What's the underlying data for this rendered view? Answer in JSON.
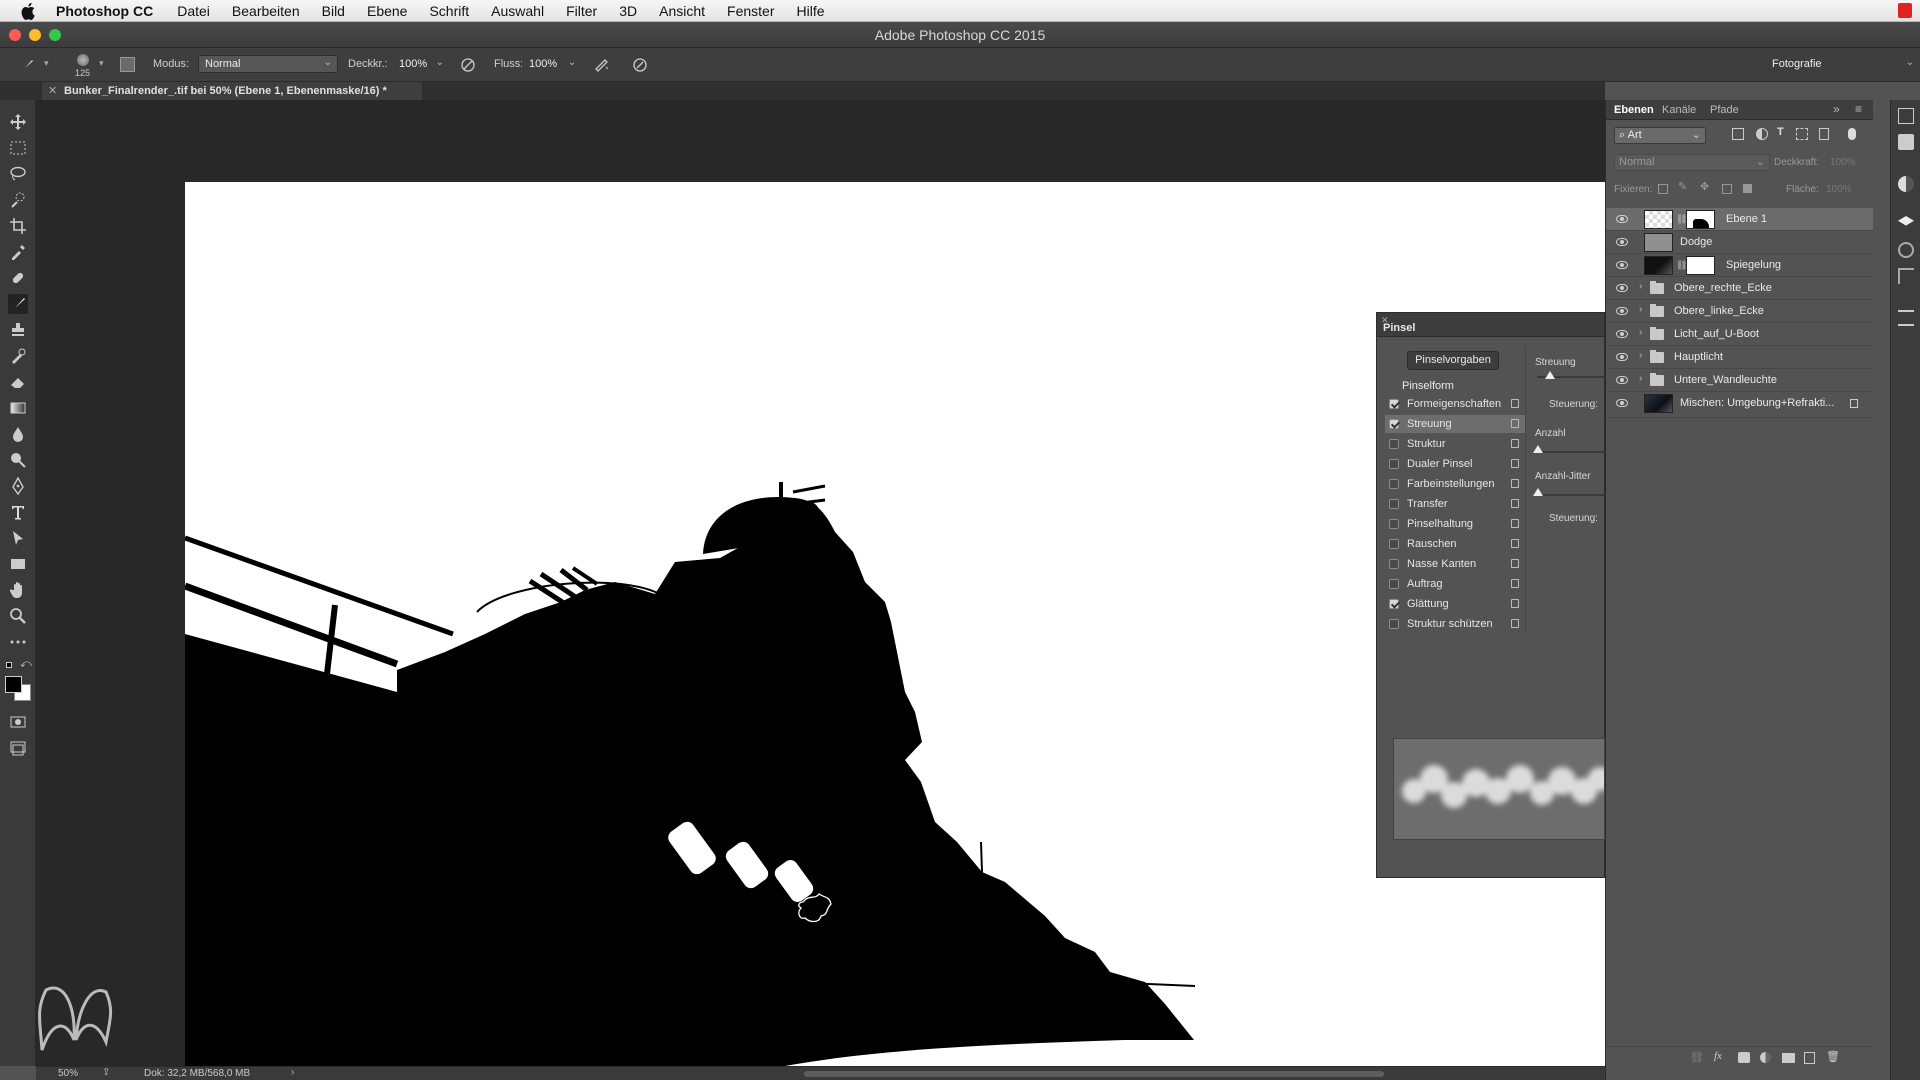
{
  "menubar": {
    "app_name": "Photoshop CC",
    "items": [
      "Datei",
      "Bearbeiten",
      "Bild",
      "Ebene",
      "Schrift",
      "Auswahl",
      "Filter",
      "3D",
      "Ansicht",
      "Fenster",
      "Hilfe"
    ]
  },
  "window": {
    "title": "Adobe Photoshop CC 2015"
  },
  "options": {
    "brush_size": "125",
    "mode_label": "Modus:",
    "mode_value": "Normal",
    "opacity_label": "Deckkr.:",
    "opacity_value": "100%",
    "flow_label": "Fluss:",
    "flow_value": "100%",
    "workspace": "Fotografie"
  },
  "document": {
    "tab_title": "Bunker_Finalrender_.tif bei 50% (Ebene 1, Ebenenmaske/16) *",
    "zoom": "50%",
    "doc_size": "Dok: 32,2 MB/568,0 MB"
  },
  "brush_panel": {
    "title": "Pinsel",
    "presets_button": "Pinselvorgaben",
    "brush_form": "Pinselform",
    "options": [
      {
        "label": "Formeigenschaften",
        "checked": true
      },
      {
        "label": "Streuung",
        "checked": true,
        "selected": true
      },
      {
        "label": "Struktur",
        "checked": false
      },
      {
        "label": "Dualer Pinsel",
        "checked": false
      },
      {
        "label": "Farbeinstellungen",
        "checked": false
      },
      {
        "label": "Transfer",
        "checked": false
      },
      {
        "label": "Pinselhaltung",
        "checked": false
      },
      {
        "label": "Rauschen",
        "checked": false
      },
      {
        "label": "Nasse Kanten",
        "checked": false
      },
      {
        "label": "Auftrag",
        "checked": false
      },
      {
        "label": "Glättung",
        "checked": true
      },
      {
        "label": "Struktur schützen",
        "checked": false
      }
    ],
    "right_labels": {
      "scatter": "Streuung",
      "control1": "Steuerung:",
      "count": "Anzahl",
      "count_jitter": "Anzahl-Jitter",
      "control2": "Steuerung:"
    }
  },
  "layers_panel": {
    "tabs": [
      "Ebenen",
      "Kanäle",
      "Pfade"
    ],
    "filter_kind": "Art",
    "blend_mode": "Normal",
    "opacity_label": "Deckkraft:",
    "opacity_value": "100%",
    "lock_label": "Fixieren:",
    "fill_label": "Fläche:",
    "fill_value": "100%",
    "layers": [
      {
        "name": "Ebene 1",
        "type": "masked",
        "active": true
      },
      {
        "name": "Dodge",
        "type": "gray"
      },
      {
        "name": "Spiegelung",
        "type": "masked-dark"
      },
      {
        "name": "Obere_rechte_Ecke",
        "type": "group"
      },
      {
        "name": "Obere_linke_Ecke",
        "type": "group"
      },
      {
        "name": "Licht_auf_U-Boot",
        "type": "group"
      },
      {
        "name": "Hauptlicht",
        "type": "group"
      },
      {
        "name": "Untere_Wandleuchte",
        "type": "group"
      },
      {
        "name": "Mischen: Umgebung+Refrakti...",
        "type": "image-locked"
      }
    ]
  },
  "colors": {
    "accent_red": "#dd2222",
    "panel_bg": "#535353",
    "canvas_bg": "#282828"
  }
}
